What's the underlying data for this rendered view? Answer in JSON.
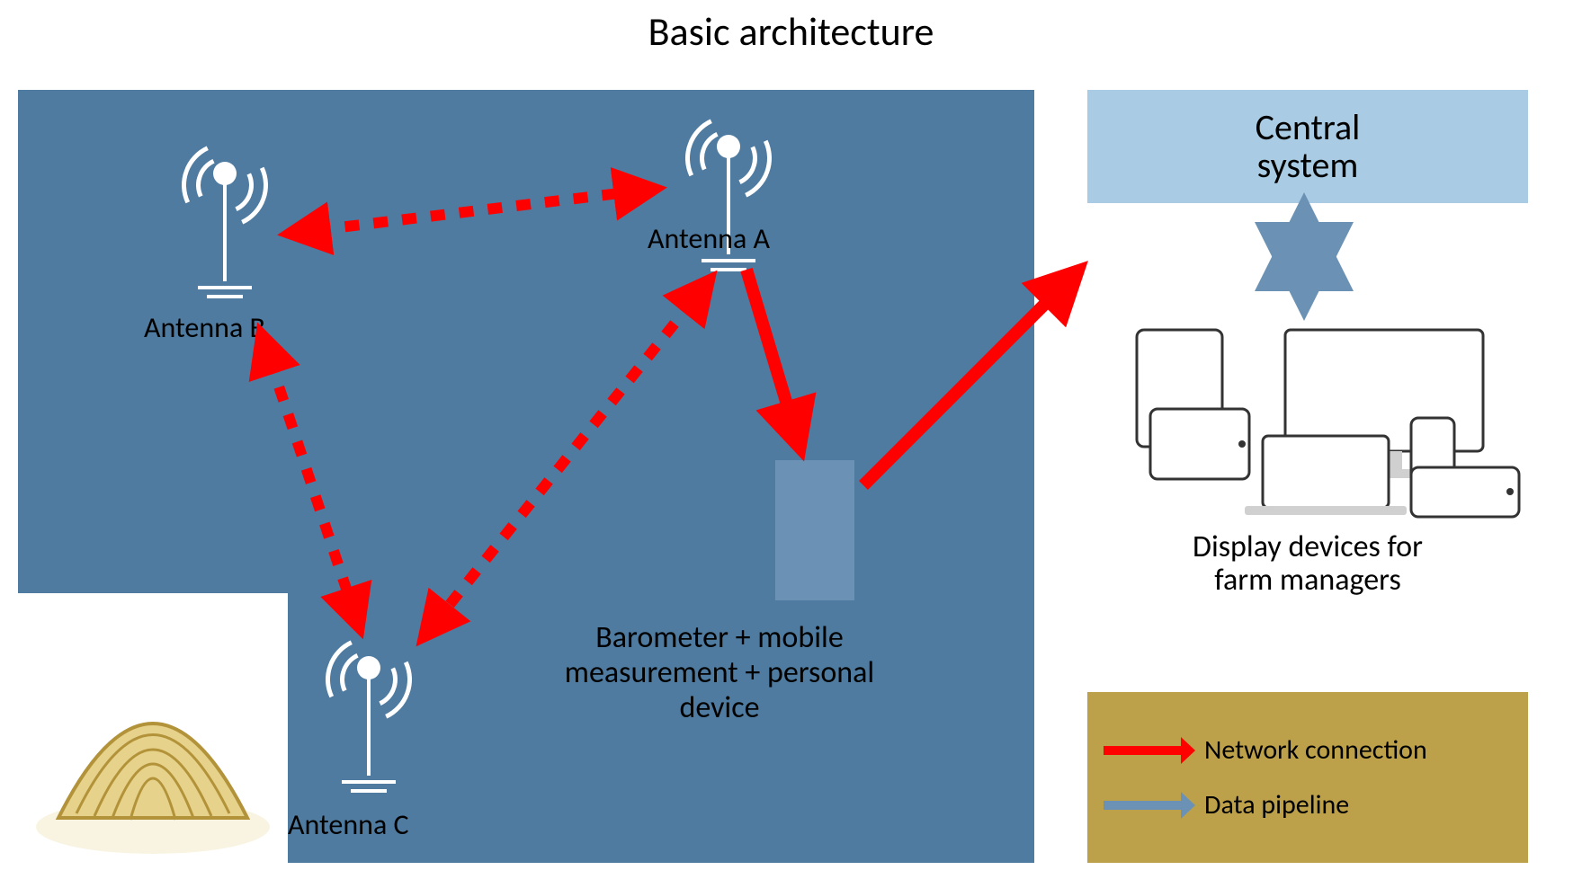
{
  "title": "Basic architecture",
  "central_system": {
    "line1": "Central",
    "line2": "system"
  },
  "display": {
    "line1": "Display devices for",
    "line2": "farm managers"
  },
  "antennas": {
    "a": "Antenna A",
    "b": "Antenna B",
    "c": "Antenna C"
  },
  "mobile": {
    "line1": "Barometer + mobile",
    "line2": "measurement + personal device"
  },
  "legend": {
    "red": "Network connection",
    "blue": "Data pipeline"
  },
  "colors": {
    "slate": "#4f7ba0",
    "lightblue": "#a9cbe3",
    "mustard": "#bda14a",
    "red": "#ff0000",
    "blue": "#6b92b4",
    "white": "#ffffff",
    "hay_fill": "#e7d28b",
    "hay_stroke": "#b3933a"
  }
}
